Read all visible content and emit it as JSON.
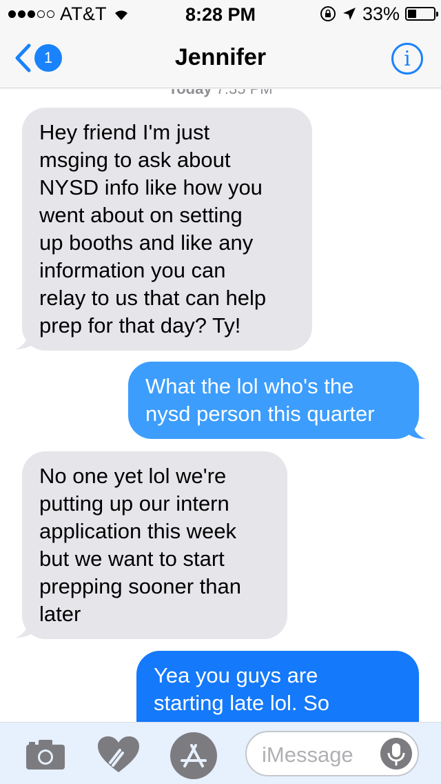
{
  "status_bar": {
    "carrier": "AT&T",
    "time": "8:28 PM",
    "battery_percent": "33%",
    "battery_level": 0.33,
    "signal_bars_filled": 3,
    "signal_bars_total": 5
  },
  "nav": {
    "back_badge_count": "1",
    "contact_name": "Jennifer",
    "info_label": "i"
  },
  "timestamp": {
    "day": "Today",
    "time": "7:35 PM"
  },
  "messages": [
    {
      "direction": "incoming",
      "lines": [
        "Hey friend I'm just",
        "msging to ask about",
        "NYSD info like how you",
        "went about on setting",
        "up booths and like any",
        "information you can",
        "relay to us that can help",
        "prep for that day? Ty!"
      ]
    },
    {
      "direction": "outgoing",
      "lines": [
        "What the lol who's the",
        "nysd person this quarter"
      ]
    },
    {
      "direction": "incoming",
      "lines": [
        "No one yet lol we're",
        "putting up our intern",
        "application this week",
        "but we want to start",
        "prepping sooner than",
        "later"
      ]
    },
    {
      "direction": "outgoing",
      "lines": [
        "Yea you guys are",
        "starting late lol. So"
      ]
    }
  ],
  "input_bar": {
    "placeholder": "iMessage",
    "icons": [
      "camera-icon",
      "digital-touch-icon",
      "app-store-icon",
      "microphone-icon"
    ]
  },
  "colors": {
    "ios_blue": "#1a82fb",
    "incoming_bubble": "#e5e5ea",
    "outgoing_bubble_top": "#3c9dfc",
    "outgoing_bubble_bottom": "#1479fa"
  }
}
